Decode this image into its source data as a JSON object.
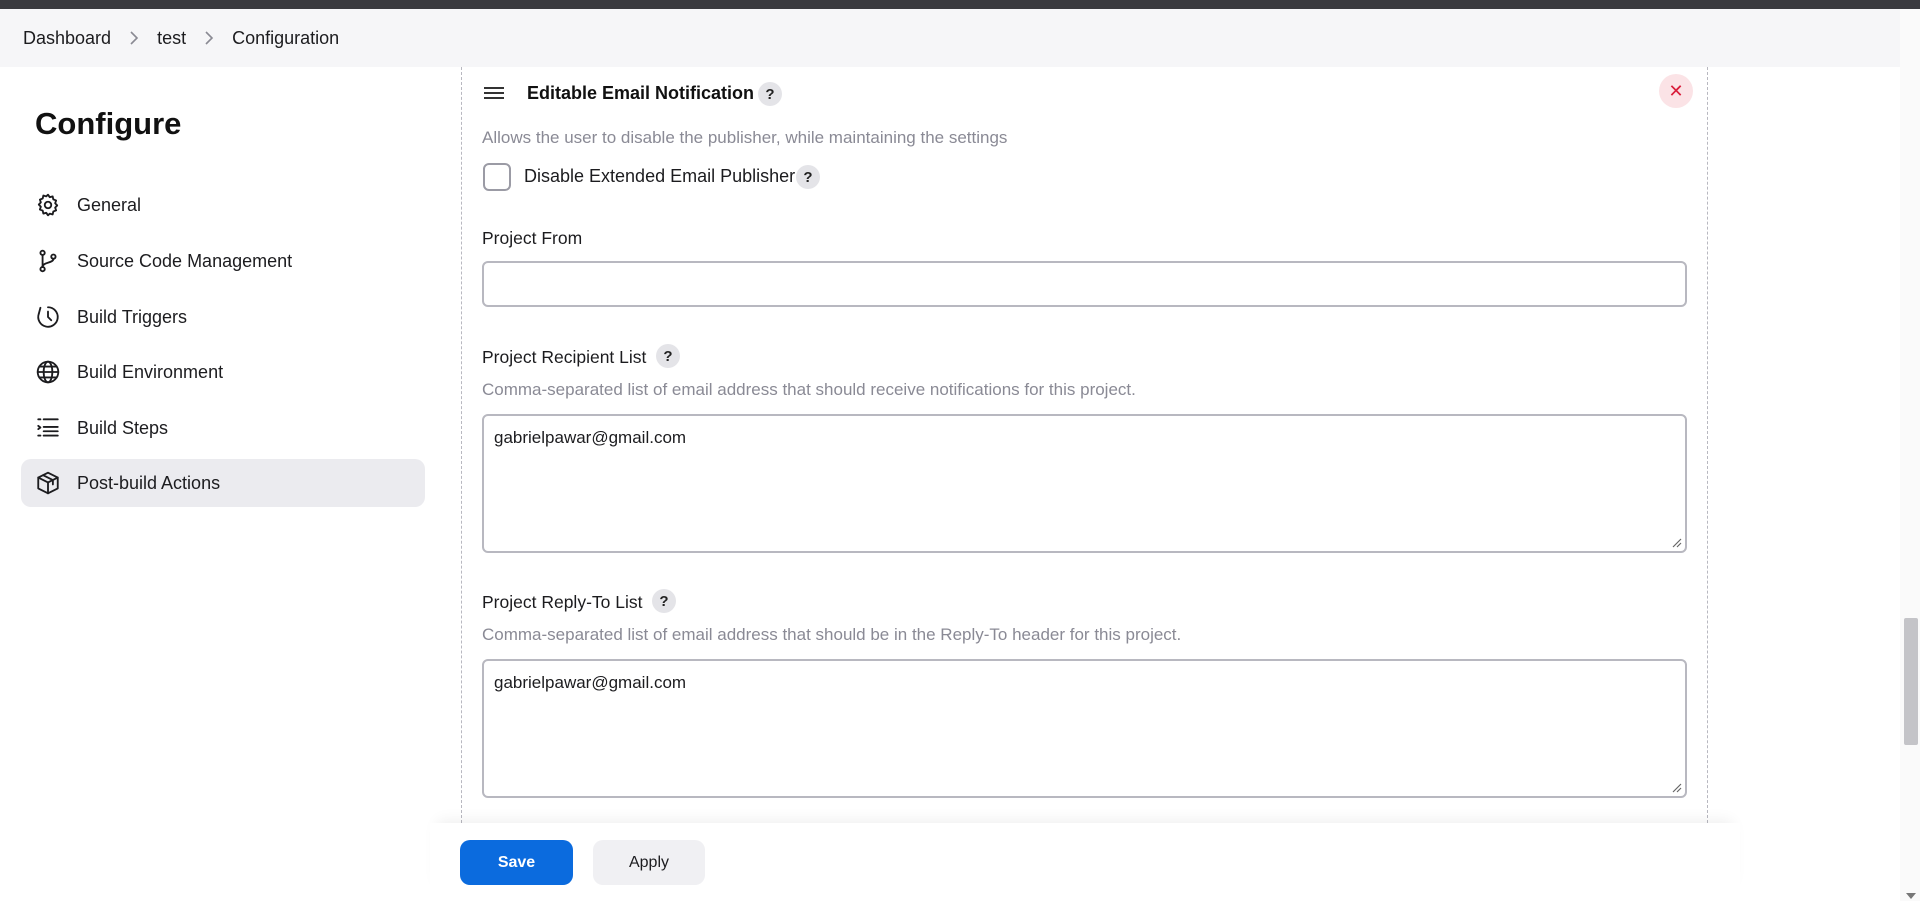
{
  "breadcrumb": {
    "items": [
      "Dashboard",
      "test",
      "Configuration"
    ]
  },
  "sidebar": {
    "title": "Configure",
    "items": [
      {
        "label": "General",
        "icon": "gear-icon"
      },
      {
        "label": "Source Code Management",
        "icon": "branch-icon"
      },
      {
        "label": "Build Triggers",
        "icon": "clock-icon"
      },
      {
        "label": "Build Environment",
        "icon": "globe-icon"
      },
      {
        "label": "Build Steps",
        "icon": "list-icon"
      },
      {
        "label": "Post-build Actions",
        "icon": "package-icon",
        "active": true
      }
    ]
  },
  "section": {
    "title": "Editable Email Notification",
    "help": "?",
    "close": "✕",
    "disable_desc": "Allows the user to disable the publisher, while maintaining the settings",
    "disable_label": "Disable Extended Email Publisher",
    "disable_checked": false,
    "project_from": {
      "label": "Project From",
      "value": ""
    },
    "recipient_list": {
      "label": "Project Recipient List",
      "desc": "Comma-separated list of email address that should receive notifications for this project.",
      "value": "gabrielpawar@gmail.com"
    },
    "reply_to_list": {
      "label": "Project Reply-To List",
      "desc": "Comma-separated list of email address that should be in the Reply-To header for this project.",
      "value": "gabrielpawar@gmail.com"
    }
  },
  "footer": {
    "save_label": "Save",
    "apply_label": "Apply"
  },
  "colors": {
    "accent": "#0b6bde",
    "danger": "#d91c3a",
    "active_nav": "#ebebef"
  }
}
